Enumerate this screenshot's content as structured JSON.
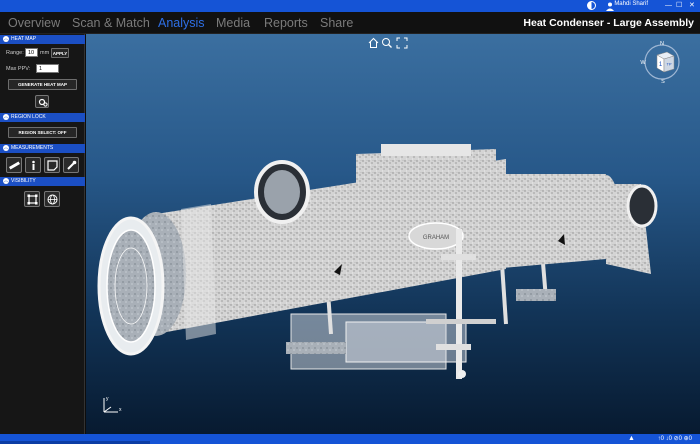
{
  "app": {
    "user_name": "Mahdi Sharif",
    "window_controls": {
      "minimize": "—",
      "maximize": "☐",
      "close": "✕"
    }
  },
  "nav": {
    "tabs": [
      {
        "label": "Overview",
        "active": false
      },
      {
        "label": "Scan & Match",
        "active": false
      },
      {
        "label": "Analysis",
        "active": true
      },
      {
        "label": "Media",
        "active": false
      },
      {
        "label": "Reports",
        "active": false
      },
      {
        "label": "Share",
        "active": false
      }
    ],
    "assembly_title": "Heat Condenser - Large Assembly"
  },
  "sidebar": {
    "heat_map": {
      "header": "HEAT MAP",
      "range_label": "Range:",
      "range_value": "10",
      "range_unit": "mm",
      "apply_label": "APPLY",
      "max_ppv_label": "Max PPV:",
      "max_ppv_value": "1",
      "generate_label": "GENERATE HEAT MAP"
    },
    "region_lock": {
      "header": "REGION LOCK",
      "region_select_label": "REGION SELECT: OFF"
    },
    "measurements": {
      "header": "MEASUREMENTS"
    },
    "visibility": {
      "header": "VISIBILITY"
    }
  },
  "viewport": {
    "nameplate": "GRAHAM",
    "viewcube": {
      "face": "1",
      "side": "TP",
      "north": "N",
      "west": "W",
      "south": "S"
    },
    "axis": {
      "y": "y",
      "x": "x"
    }
  },
  "status": {
    "counts": "↑0  ↓0  ⊘0  ⊕0"
  },
  "colors": {
    "accent": "#1554d6",
    "active_tab": "#2e6fe6",
    "sidebar_bg": "#161616"
  }
}
